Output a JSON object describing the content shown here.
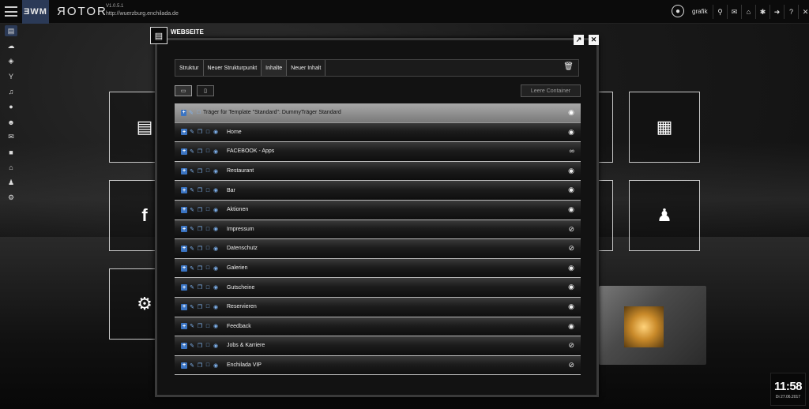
{
  "app": {
    "logo_text": "ƎWM",
    "brand": "ЯOTOR",
    "version": "V1.0.5.1",
    "site_url": "http://wuerzburg.enchilada.de"
  },
  "user": {
    "name": "grafik"
  },
  "top_icons": [
    "search-icon",
    "chat-icon",
    "home-icon",
    "spinner-icon",
    "logout-icon",
    "help-icon",
    "close-icon"
  ],
  "sidebar_icons": [
    "sitemap-icon",
    "cloud-icon",
    "cube-icon",
    "cocktail-icon",
    "restaurant-icon",
    "pin-icon",
    "users-icon",
    "mail-icon",
    "file-icon",
    "home-icon",
    "user-icon",
    "gears-icon"
  ],
  "modal": {
    "title": "WEBSEITE",
    "tabs": [
      "Struktur",
      "Neuer Strukturpunkt",
      "Inhalte",
      "Neuer Inhalt"
    ],
    "active_tab": "Inhalte",
    "empty_button": "Leere Container",
    "header_row": "Träger für Template \"Standard\": DummyTräger Standard",
    "rows": [
      {
        "label": "Home",
        "status": "visible"
      },
      {
        "label": "FACEBOOK - Apps",
        "status": "link"
      },
      {
        "label": "Restaurant",
        "status": "visible"
      },
      {
        "label": "Bar",
        "status": "visible"
      },
      {
        "label": "Aktionen",
        "status": "visible"
      },
      {
        "label": "Impressum",
        "status": "hidden"
      },
      {
        "label": "Datenschutz",
        "status": "hidden"
      },
      {
        "label": "Galerien",
        "status": "visible"
      },
      {
        "label": "Gutscheine",
        "status": "visible"
      },
      {
        "label": "Reservieren",
        "status": "visible"
      },
      {
        "label": "Feedback",
        "status": "visible"
      },
      {
        "label": "Jobs & Karriere",
        "status": "hidden"
      },
      {
        "label": "Enchilada VIP",
        "status": "hidden"
      }
    ]
  },
  "clock": {
    "time": "11:58",
    "date": "Di 27.06.2017"
  }
}
